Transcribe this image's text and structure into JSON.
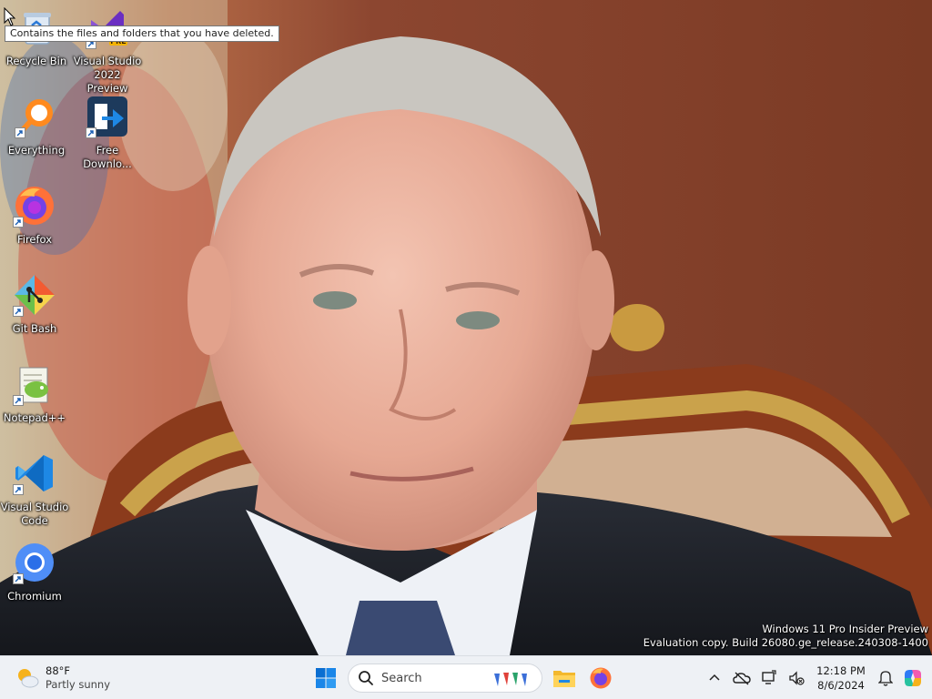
{
  "desktop": {
    "icons": [
      {
        "label": "Recycle Bin",
        "icon": "recycle-bin-icon"
      },
      {
        "label": "Visual Studio 2022 Preview",
        "icon": "visual-studio-preview-icon",
        "badge": "PRE"
      },
      {
        "label": "Everything",
        "icon": "everything-search-icon"
      },
      {
        "label": "Free Downlo...",
        "icon": "free-download-manager-icon"
      },
      {
        "label": "Firefox",
        "icon": "firefox-icon"
      },
      {
        "label": "Git Bash",
        "icon": "git-bash-icon"
      },
      {
        "label": "Notepad++",
        "icon": "notepad-plus-plus-icon"
      },
      {
        "label": "Visual Studio Code",
        "icon": "vscode-icon"
      },
      {
        "label": "Chromium",
        "icon": "chromium-icon"
      }
    ],
    "tooltip": "Contains the files and folders that you have deleted.",
    "watermark": {
      "line1": "Windows 11 Pro Insider Preview",
      "line2": "Evaluation copy. Build 26080.ge_release.240308-1400"
    }
  },
  "taskbar": {
    "weather": {
      "temp": "88°F",
      "condition": "Partly sunny",
      "icon": "partly-sunny-icon"
    },
    "start_icon": "windows-start-icon",
    "search": {
      "label": "Search"
    },
    "pinned": [
      {
        "name": "file-explorer",
        "icon": "file-explorer-icon"
      },
      {
        "name": "firefox",
        "icon": "firefox-icon"
      }
    ],
    "tray": {
      "icons": [
        "chevron-up-icon",
        "onedrive-offline-icon",
        "network-icon",
        "volume-muted-icon"
      ],
      "time": "12:18 PM",
      "date": "8/6/2024",
      "notification_icon": "bell-icon",
      "copilot_icon": "copilot-icon"
    }
  },
  "colors": {
    "taskbar_bg": "#eef1f5",
    "windows_blue": "#0a6ed1",
    "vscode_blue": "#1e88e5",
    "firefox_orange": "#ff7139"
  }
}
